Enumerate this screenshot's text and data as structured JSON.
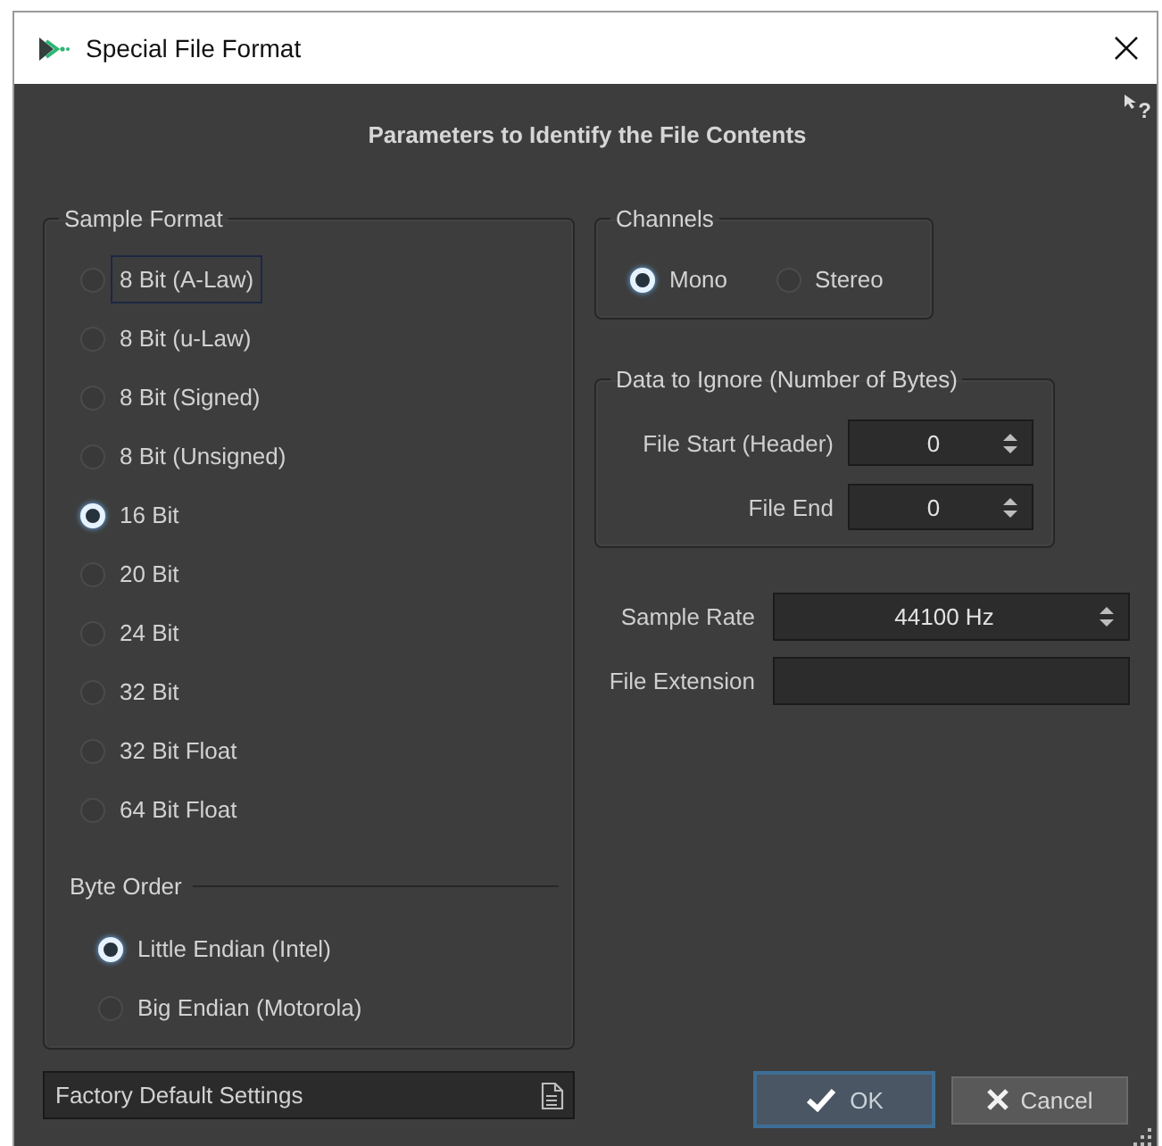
{
  "window": {
    "title": "Special File Format",
    "help_label": "?"
  },
  "heading": "Parameters to Identify the File Contents",
  "sample_format": {
    "label": "Sample Format",
    "options": [
      {
        "label": "8 Bit (A-Law)",
        "selected": false,
        "focused": true
      },
      {
        "label": "8 Bit (u-Law)",
        "selected": false,
        "focused": false
      },
      {
        "label": "8 Bit (Signed)",
        "selected": false,
        "focused": false
      },
      {
        "label": "8 Bit (Unsigned)",
        "selected": false,
        "focused": false
      },
      {
        "label": "16 Bit",
        "selected": true,
        "focused": false
      },
      {
        "label": "20 Bit",
        "selected": false,
        "focused": false
      },
      {
        "label": "24 Bit",
        "selected": false,
        "focused": false
      },
      {
        "label": "32 Bit",
        "selected": false,
        "focused": false
      },
      {
        "label": "32 Bit Float",
        "selected": false,
        "focused": false
      },
      {
        "label": "64 Bit Float",
        "selected": false,
        "focused": false
      }
    ],
    "byte_order": {
      "label": "Byte Order",
      "options": [
        {
          "label": "Little Endian (Intel)",
          "selected": true
        },
        {
          "label": "Big Endian (Motorola)",
          "selected": false
        }
      ]
    }
  },
  "channels": {
    "label": "Channels",
    "options": [
      {
        "label": "Mono",
        "selected": true
      },
      {
        "label": "Stereo",
        "selected": false
      }
    ]
  },
  "data_to_ignore": {
    "label": "Data to Ignore (Number of Bytes)",
    "fields": [
      {
        "label": "File Start (Header)",
        "value": "0"
      },
      {
        "label": "File End",
        "value": "0"
      }
    ]
  },
  "settings": [
    {
      "label": "Sample Rate",
      "kind": "spinner",
      "value": "44100 Hz"
    },
    {
      "label": "File Extension",
      "kind": "text"
    }
  ],
  "preset": {
    "value": "Factory Default Settings"
  },
  "buttons": [
    {
      "label": "OK",
      "kind": "ok"
    },
    {
      "label": "Cancel",
      "kind": "cancel"
    }
  ]
}
